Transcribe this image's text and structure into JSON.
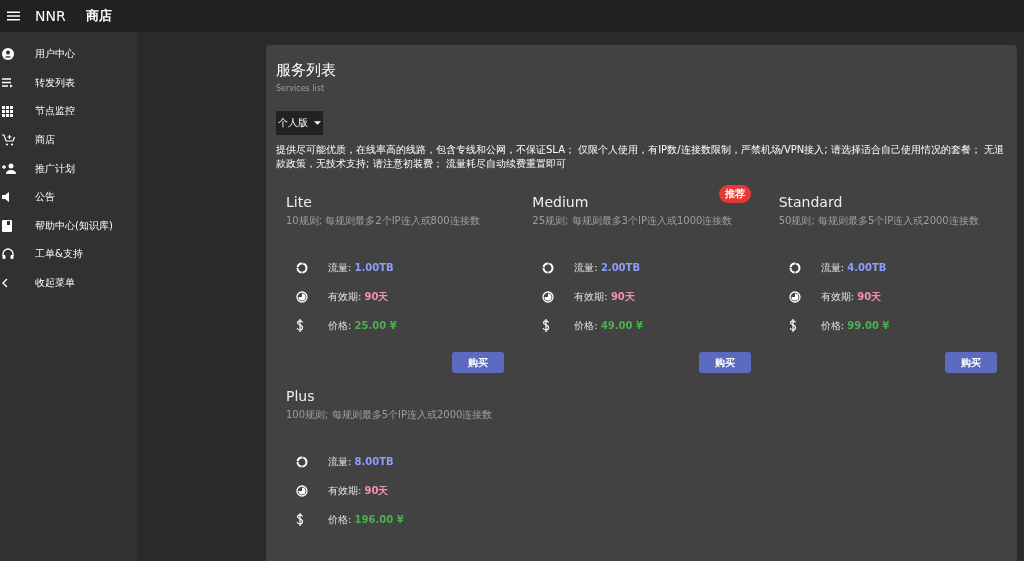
{
  "app_bar": {
    "brand": "NNR",
    "title": "商店"
  },
  "sidebar": {
    "items": [
      {
        "kind": "account",
        "label": "用户中心"
      },
      {
        "kind": "list",
        "label": "转发列表"
      },
      {
        "kind": "grid",
        "label": "节点监控"
      },
      {
        "kind": "cart",
        "label": "商店"
      },
      {
        "kind": "invite",
        "label": "推广计划"
      },
      {
        "kind": "notice",
        "label": "公告"
      },
      {
        "kind": "help",
        "label": "帮助中心(知识库)"
      },
      {
        "kind": "support",
        "label": "工单&支持"
      },
      {
        "kind": "collapse",
        "label": "收起菜单"
      }
    ]
  },
  "panel": {
    "title": "服务列表",
    "subtitle": "Services list",
    "plan_type": "个人版",
    "notice": "提供尽可能优质，在线率高的线路，包含专线和公网，不保证SLA； 仅限个人使用，有IP数/连接数限制，严禁机场/VPN接入; 请选择适合自己使用情况的套餐； 无退款政策，无技术支持; 请注意初装费； 流量耗尽自动续费重置即可",
    "plans": [
      {
        "name": "Lite",
        "description": "10规则; 每规则最多2个IP连入或800连接数",
        "stats": [
          {
            "kind": "traffic",
            "label": "流量:",
            "value": "1.00TB"
          },
          {
            "kind": "validity",
            "label": "有效期:",
            "value": "90天"
          },
          {
            "kind": "price",
            "label": "价格:",
            "value": "25.00 ¥"
          }
        ],
        "button": "购买"
      },
      {
        "name": "Medium",
        "badge": "推荐",
        "description": "25规则; 每规则最多3个IP连入或1000连接数",
        "stats": [
          {
            "kind": "traffic",
            "label": "流量:",
            "value": "2.00TB"
          },
          {
            "kind": "validity",
            "label": "有效期:",
            "value": "90天"
          },
          {
            "kind": "price",
            "label": "价格:",
            "value": "49.00 ¥"
          }
        ],
        "button": "购买"
      },
      {
        "name": "Standard",
        "description": "50规则; 每规则最多5个IP连入或2000连接数",
        "stats": [
          {
            "kind": "traffic",
            "label": "流量:",
            "value": "4.00TB"
          },
          {
            "kind": "validity",
            "label": "有效期:",
            "value": "90天"
          },
          {
            "kind": "price",
            "label": "价格:",
            "value": "99.00 ¥"
          }
        ],
        "button": "购买"
      },
      {
        "name": "Plus",
        "description": "100规则; 每规则最多5个IP连入或2000连接数",
        "stats": [
          {
            "kind": "traffic",
            "label": "流量:",
            "value": "8.00TB"
          },
          {
            "kind": "validity",
            "label": "有效期:",
            "value": "90天"
          },
          {
            "kind": "price",
            "label": "价格:",
            "value": "196.00 ¥"
          }
        ]
      }
    ]
  }
}
